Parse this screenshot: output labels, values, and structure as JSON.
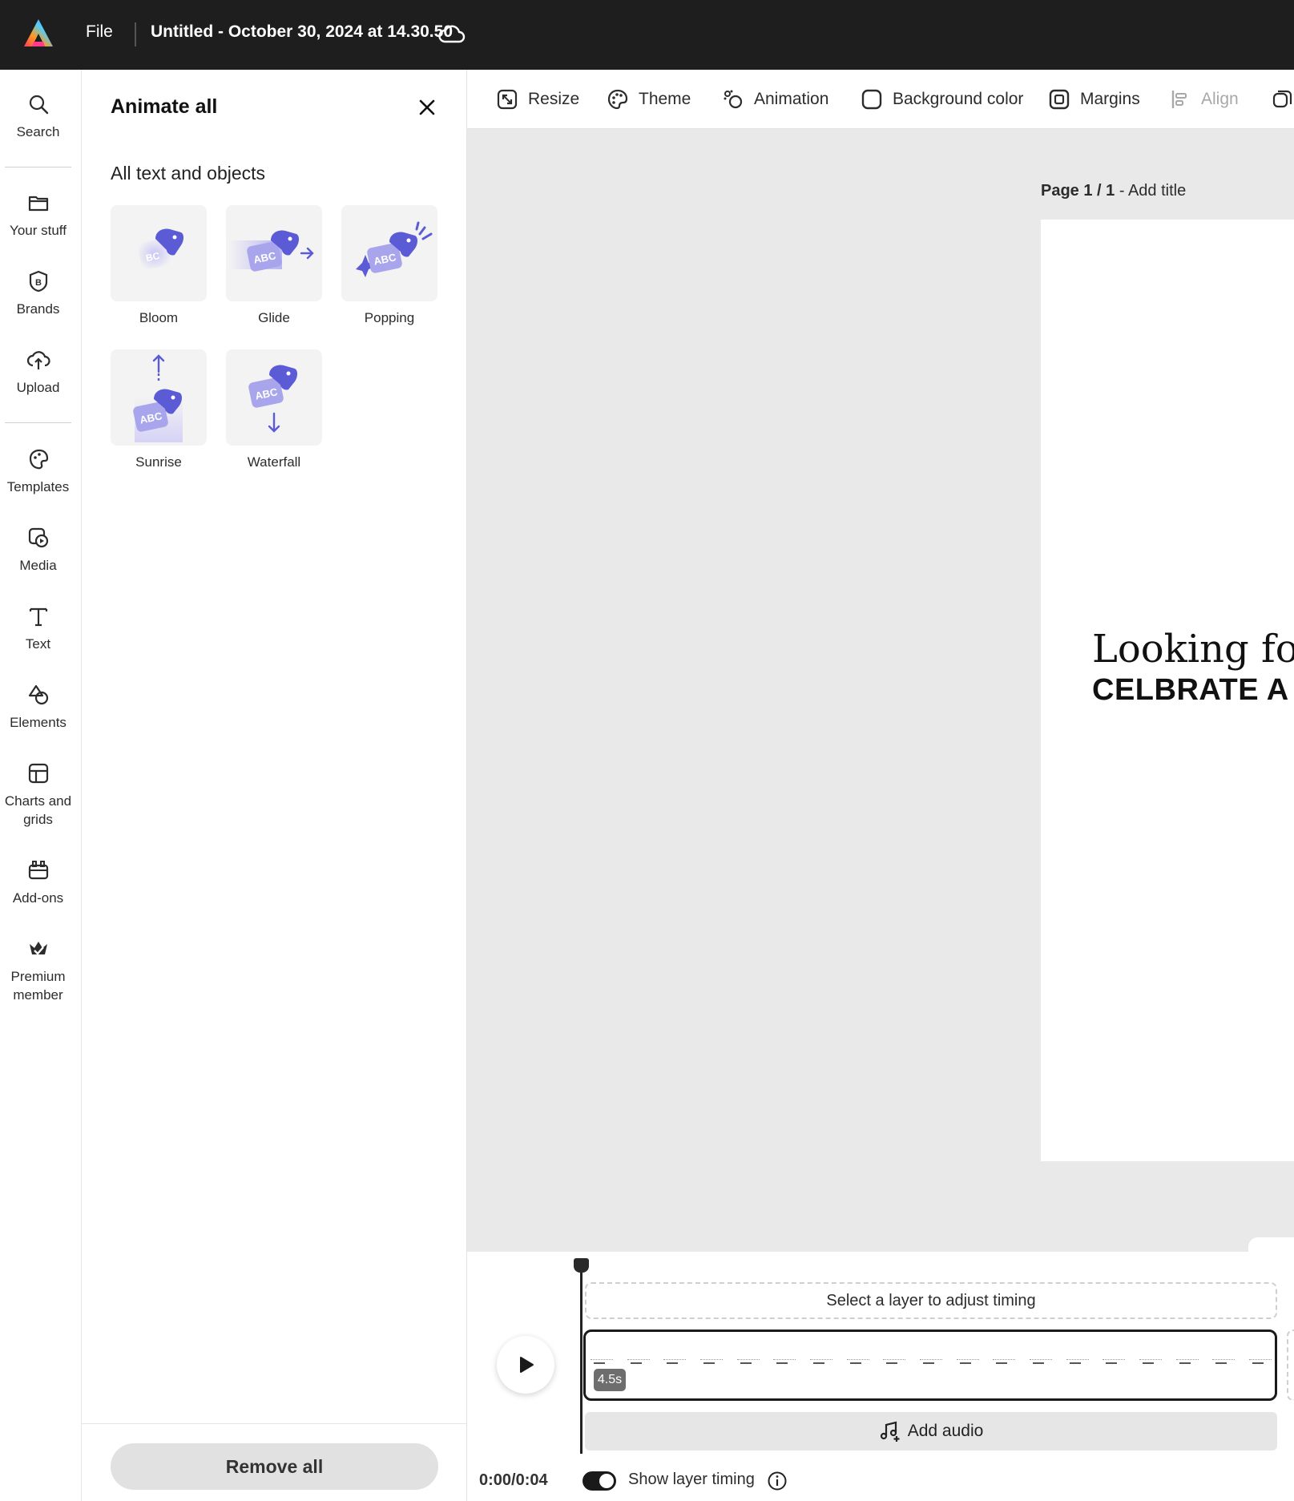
{
  "topbar": {
    "file_label": "File",
    "doc_title": "Untitled - October 30, 2024 at 14.30.50",
    "logo_icon": "adobe-express-logo",
    "cloud_icon": "cloud-icon"
  },
  "rail": {
    "items": [
      {
        "label": "Search",
        "icon": "search-icon"
      },
      {
        "label": "Your stuff",
        "icon": "folder-icon"
      },
      {
        "label": "Brands",
        "icon": "brand-icon"
      },
      {
        "label": "Upload",
        "icon": "upload-icon"
      },
      {
        "label": "Templates",
        "icon": "templates-icon"
      },
      {
        "label": "Media",
        "icon": "media-icon"
      },
      {
        "label": "Text",
        "icon": "text-icon"
      },
      {
        "label": "Elements",
        "icon": "elements-icon"
      },
      {
        "label": "Charts and grids",
        "icon": "charts-icon"
      },
      {
        "label": "Add-ons",
        "icon": "addons-icon"
      },
      {
        "label": "Premium member",
        "icon": "premium-crown-icon"
      }
    ]
  },
  "panel": {
    "title": "Animate all",
    "subtitle": "All text and objects",
    "animations": [
      {
        "label": "Bloom"
      },
      {
        "label": "Glide"
      },
      {
        "label": "Popping"
      },
      {
        "label": "Sunrise"
      },
      {
        "label": "Waterfall"
      }
    ],
    "remove_all_label": "Remove all"
  },
  "toolbar": {
    "items": [
      {
        "label": "Resize",
        "icon": "resize-icon",
        "disabled": false
      },
      {
        "label": "Theme",
        "icon": "palette-icon",
        "disabled": false
      },
      {
        "label": "Animation",
        "icon": "animation-icon",
        "disabled": false
      },
      {
        "label": "Background color",
        "icon": "background-color-icon",
        "disabled": false
      },
      {
        "label": "Margins",
        "icon": "margins-icon",
        "disabled": false
      },
      {
        "label": "Align",
        "icon": "align-icon",
        "disabled": true
      }
    ]
  },
  "canvas": {
    "page_number": "Page 1 / 1",
    "page_title_separator": " - ",
    "page_title_placeholder": "Add title",
    "text_line1": "Looking for",
    "text_line2": "CELBRATE A"
  },
  "timeline": {
    "layer_hint": "Select a layer to adjust timing",
    "duration_badge": "4.5s",
    "add_audio_label": "Add audio",
    "time_readout": "0:00/0:04",
    "show_layer_timing_label": "Show layer timing",
    "show_layer_timing_on": true,
    "thumbnail_count": 19
  },
  "colors": {
    "topbar_bg": "#1e1e1e",
    "canvas_bg": "#e9e9e9",
    "accent_purple": "#5b5bd6"
  }
}
